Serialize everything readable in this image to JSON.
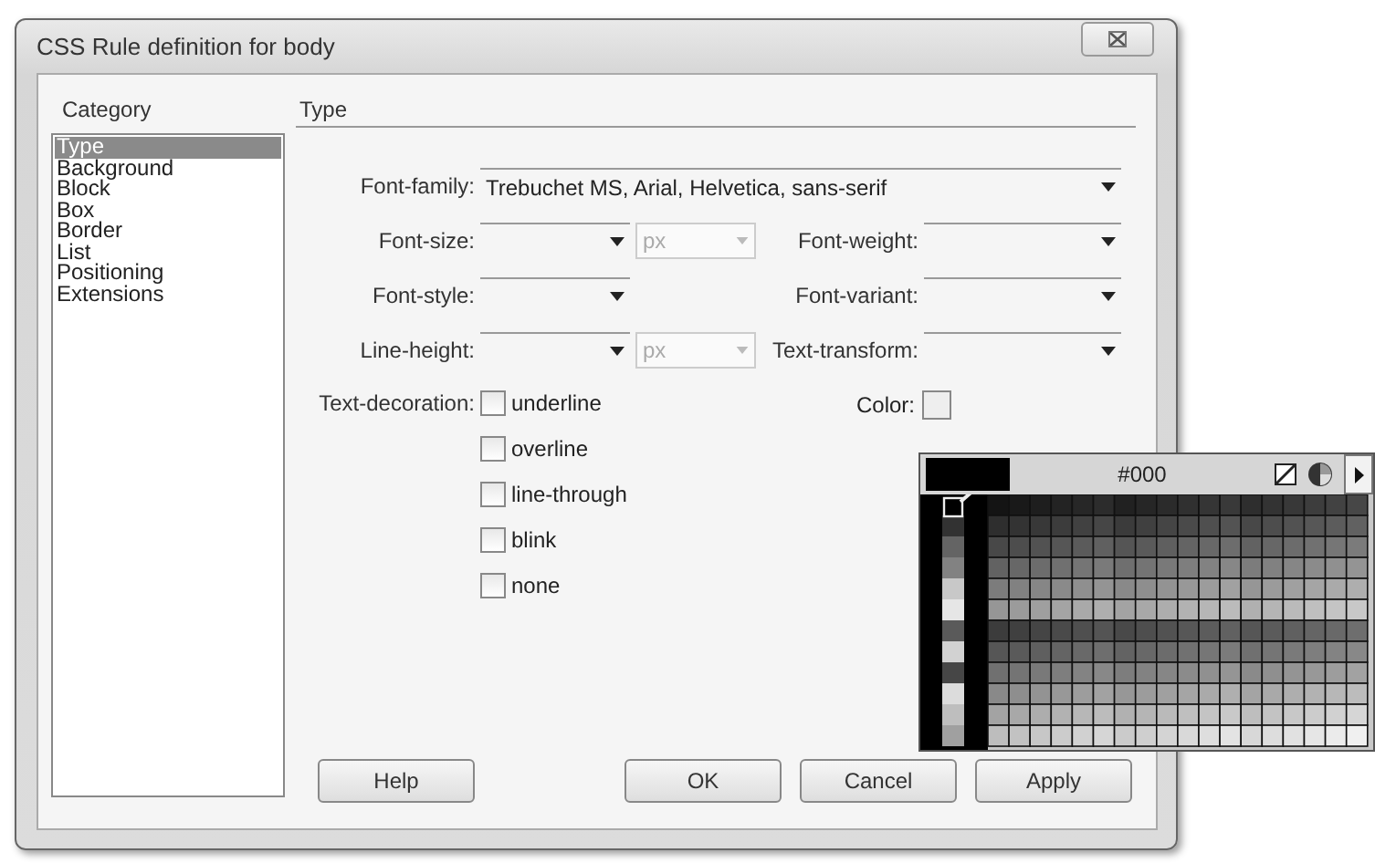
{
  "window": {
    "title": "CSS Rule definition for body"
  },
  "category": {
    "heading": "Category",
    "items": [
      {
        "label": "Type",
        "selected": true
      },
      {
        "label": "Background",
        "selected": false
      },
      {
        "label": "Block",
        "selected": false
      },
      {
        "label": "Box",
        "selected": false
      },
      {
        "label": "Border",
        "selected": false
      },
      {
        "label": "List",
        "selected": false
      },
      {
        "label": "Positioning",
        "selected": false
      },
      {
        "label": "Extensions",
        "selected": false
      }
    ]
  },
  "panel": {
    "heading": "Type"
  },
  "font_family": {
    "label": "Font-family:",
    "value": "Trebuchet MS, Arial, Helvetica, sans-serif"
  },
  "font_size": {
    "label": "Font-size:",
    "unit": "px",
    "unit_disabled": true
  },
  "font_weight": {
    "label": "Font-weight:"
  },
  "font_style": {
    "label": "Font-style:"
  },
  "font_variant": {
    "label": "Font-variant:"
  },
  "line_height": {
    "label": "Line-height:",
    "unit": "px",
    "unit_disabled": true
  },
  "text_transform": {
    "label": "Text-transform:"
  },
  "text_decoration": {
    "label": "Text-decoration:",
    "options": [
      {
        "label": "underline",
        "checked": false
      },
      {
        "label": "overline",
        "checked": false
      },
      {
        "label": "line-through",
        "checked": false
      },
      {
        "label": "blink",
        "checked": false
      },
      {
        "label": "none",
        "checked": false
      }
    ]
  },
  "color": {
    "label": "Color:",
    "picker": {
      "hex": "#000"
    }
  },
  "buttons": [
    {
      "label": "Help",
      "kind": "help"
    },
    {
      "label": "OK",
      "kind": "action"
    },
    {
      "label": "Cancel",
      "kind": "action"
    },
    {
      "label": "Apply",
      "kind": "action"
    }
  ]
}
